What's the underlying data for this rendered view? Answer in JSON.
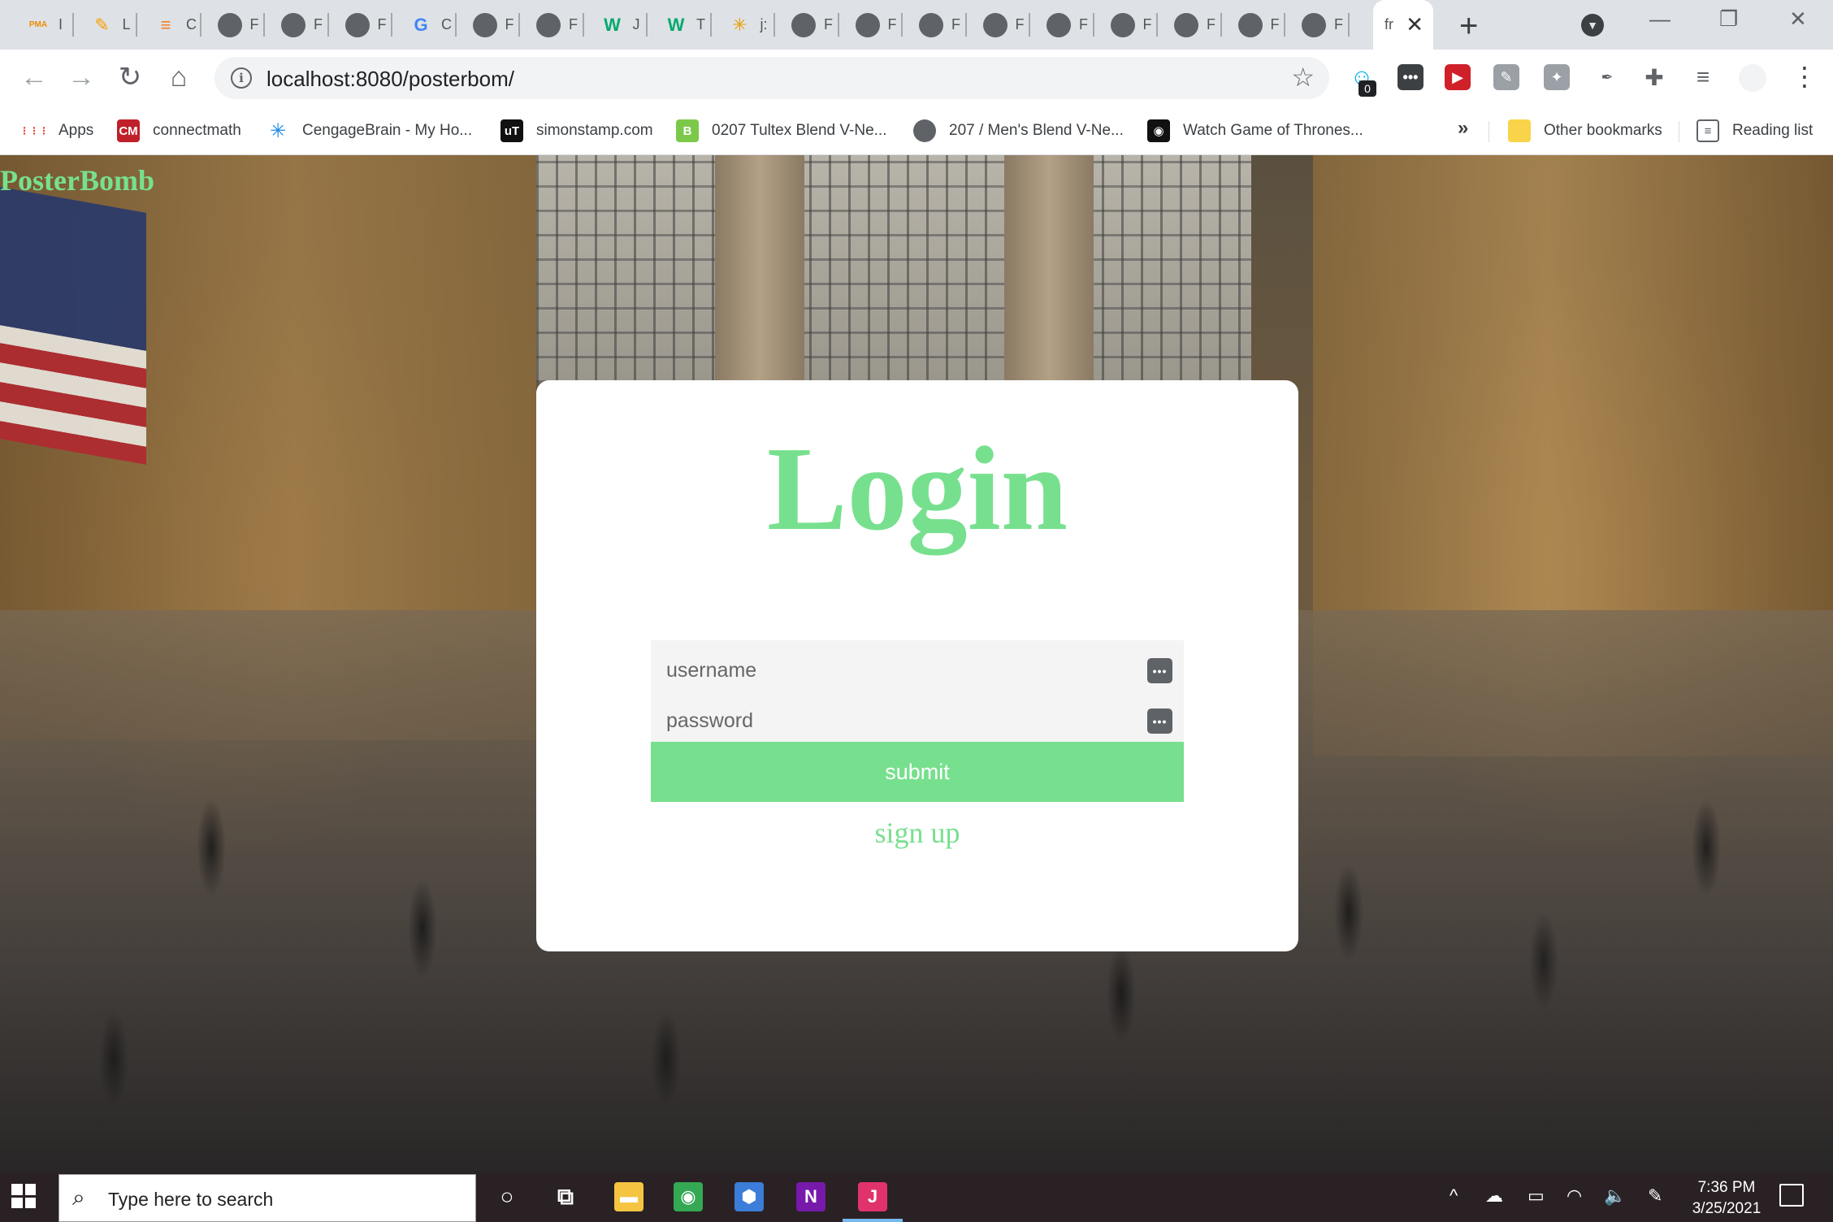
{
  "browser": {
    "tabs": [
      {
        "icon": "pma-icon",
        "glyph": "PMA",
        "label": "I",
        "color": "#f08c00"
      },
      {
        "icon": "notes-icon",
        "glyph": "✎",
        "label": "L",
        "color": "#f59f00"
      },
      {
        "icon": "stackoverflow-icon",
        "glyph": "≡",
        "label": "C",
        "color": "#f48024"
      },
      {
        "icon": "globe-icon",
        "glyph": "",
        "label": "F",
        "color": "#5f6368"
      },
      {
        "icon": "globe-icon",
        "glyph": "",
        "label": "F",
        "color": "#5f6368"
      },
      {
        "icon": "globe-icon",
        "glyph": "",
        "label": "F",
        "color": "#5f6368"
      },
      {
        "icon": "google-icon",
        "glyph": "G",
        "label": "C",
        "color": "#4285f4"
      },
      {
        "icon": "globe-icon",
        "glyph": "",
        "label": "F",
        "color": "#5f6368"
      },
      {
        "icon": "globe-icon",
        "glyph": "",
        "label": "F",
        "color": "#5f6368"
      },
      {
        "icon": "w3schools-icon",
        "glyph": "W",
        "label": "J",
        "color": "#04aa6d"
      },
      {
        "icon": "w3schools-icon",
        "glyph": "W",
        "label": "T",
        "color": "#04aa6d"
      },
      {
        "icon": "spark-icon",
        "glyph": "✳",
        "label": "j:",
        "color": "#e8a000"
      },
      {
        "icon": "globe-icon",
        "glyph": "",
        "label": "F",
        "color": "#5f6368"
      },
      {
        "icon": "globe-icon",
        "glyph": "",
        "label": "F",
        "color": "#5f6368"
      },
      {
        "icon": "globe-icon",
        "glyph": "",
        "label": "F",
        "color": "#5f6368"
      },
      {
        "icon": "globe-icon",
        "glyph": "",
        "label": "F",
        "color": "#5f6368"
      },
      {
        "icon": "globe-icon",
        "glyph": "",
        "label": "F",
        "color": "#5f6368"
      },
      {
        "icon": "globe-icon",
        "glyph": "",
        "label": "F",
        "color": "#5f6368"
      },
      {
        "icon": "globe-icon",
        "glyph": "",
        "label": "F",
        "color": "#5f6368"
      },
      {
        "icon": "globe-icon",
        "glyph": "",
        "label": "F",
        "color": "#5f6368"
      },
      {
        "icon": "globe-icon",
        "glyph": "",
        "label": "F",
        "color": "#5f6368"
      }
    ],
    "active_tab": {
      "label": "fr",
      "close": "✕"
    },
    "new_tab": "+",
    "window_controls": {
      "minimize": "—",
      "restore": "❐",
      "close": "✕"
    },
    "nav": {
      "back": "←",
      "forward": "→",
      "reload": "↻",
      "home": "⌂"
    },
    "address": {
      "url": "localhost:8080/posterbom/",
      "info": "i",
      "star": "☆"
    },
    "extensions": [
      {
        "icon": "ghostery-icon",
        "glyph": "☺",
        "color": "#00aef0"
      },
      {
        "icon": "dots-extension-icon",
        "glyph": "•••",
        "color": "#3c4043"
      },
      {
        "icon": "rewind-extension-icon",
        "glyph": "▶",
        "color": "#d0202a"
      },
      {
        "icon": "edit-extension-icon",
        "glyph": "✎",
        "color": "#9aa0a6"
      },
      {
        "icon": "pin-extension-icon",
        "glyph": "✦",
        "color": "#9aa0a6"
      },
      {
        "icon": "eyedropper-extension-icon",
        "glyph": "✒",
        "color": "#5f6368"
      },
      {
        "icon": "puzzle-extensions-icon",
        "glyph": "✚",
        "color": "#5f6368"
      },
      {
        "icon": "media-queue-icon",
        "glyph": "≡",
        "color": "#5f6368"
      }
    ],
    "ghostery_badge": "0",
    "menu": "⋮",
    "bookmarks": [
      {
        "icon": "apps-grid-icon",
        "glyph": "⋮⋮⋮",
        "label": "Apps",
        "color": "#ea4335"
      },
      {
        "icon": "connectmath-icon",
        "glyph": "CM",
        "label": "connectmath",
        "color": "#c0202a"
      },
      {
        "icon": "cengagebrain-icon",
        "glyph": "✳",
        "label": "CengageBrain - My Ho...",
        "color": "#1e88e5"
      },
      {
        "icon": "utorrent-icon",
        "glyph": "uT",
        "label": "simonstamp.com",
        "color": "#111111"
      },
      {
        "icon": "blend-icon",
        "glyph": "B",
        "label": "0207 Tultex Blend V-Ne...",
        "color": "#7cc94a"
      },
      {
        "icon": "globe-icon",
        "glyph": "",
        "label": "207 / Men's Blend V-Ne...",
        "color": "#5f6368"
      },
      {
        "icon": "got-icon",
        "glyph": "◉",
        "label": "Watch Game of Thrones...",
        "color": "#111111"
      }
    ],
    "bookmarks_more": "»",
    "other_bookmarks": "Other bookmarks",
    "reading_list": "Reading list"
  },
  "page": {
    "brand": "PosterBomb",
    "login": {
      "title": "Login",
      "username_placeholder": "username",
      "password_placeholder": "password",
      "submit_label": "submit",
      "signup_label": "sign up",
      "field_icon": "•••"
    },
    "accent_color": "#77e08e"
  },
  "taskbar": {
    "search_placeholder": "Type here to search",
    "apps": [
      {
        "icon": "cortana-icon",
        "glyph": "○",
        "color": "transparent"
      },
      {
        "icon": "task-view-icon",
        "glyph": "⧉",
        "color": "transparent"
      },
      {
        "icon": "file-explorer-icon",
        "glyph": "▬",
        "color": "#f5c542"
      },
      {
        "icon": "chrome-icon",
        "glyph": "◉",
        "color": "#34a853"
      },
      {
        "icon": "app-cube-icon",
        "glyph": "⬢",
        "color": "#3b7dd8"
      },
      {
        "icon": "onenote-icon",
        "glyph": "N",
        "color": "#7719aa"
      },
      {
        "icon": "intellij-icon",
        "glyph": "J",
        "color": "#e0336b"
      }
    ],
    "tray": {
      "chevron": "^",
      "onedrive": "☁",
      "battery": "▭",
      "wifi": "◠",
      "volume": "🔈",
      "pen": "✎"
    },
    "time": "7:36 PM",
    "date": "3/25/2021"
  }
}
